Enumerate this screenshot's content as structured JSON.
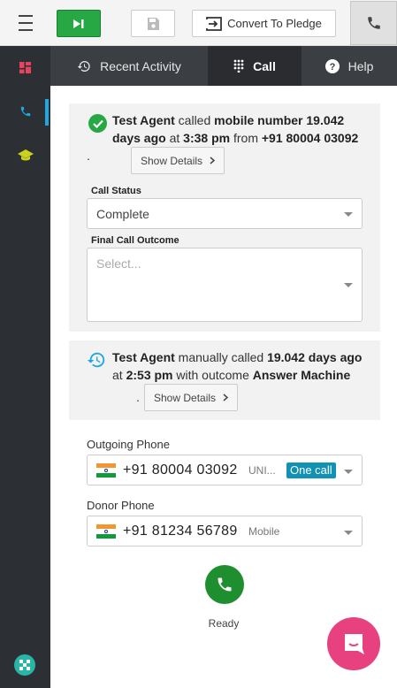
{
  "topbar": {
    "convert_label": "Convert To Pledge"
  },
  "tabs": [
    {
      "label": "Recent Activity"
    },
    {
      "label": "Call"
    },
    {
      "label": "Help"
    }
  ],
  "activity1": {
    "agent": "Test Agent",
    "verb": " called ",
    "target": "mobile number",
    "time_ago": "19.042 days ago",
    "at": " at ",
    "time": "3:38 pm",
    "from": " from ",
    "number": "+91 80004 03092",
    "period": ".",
    "show_details": "Show Details"
  },
  "call_status": {
    "label": "Call Status",
    "value": "Complete"
  },
  "final_outcome": {
    "label": "Final Call Outcome",
    "placeholder": "Select..."
  },
  "activity2": {
    "agent": "Test Agent",
    "verb": " manually called ",
    "time_ago": "19.042 days ago",
    "at": " at ",
    "time": "2:53 pm",
    "with": " with outcome ",
    "outcome": "Answer Machine",
    "period": ".",
    "show_details": "Show Details"
  },
  "outgoing_phone": {
    "label": "Outgoing Phone",
    "number": "+91 80004 03092",
    "type": "UNI...",
    "badge": "One call"
  },
  "donor_phone": {
    "label": "Donor Phone",
    "number": "+91 81234 56789",
    "type": "Mobile"
  },
  "call_state": "Ready",
  "colors": {
    "sidebar_bg": "#2c2f33",
    "tab_bg": "#3b3f44",
    "active_tab_bg": "#2a2c30",
    "success_green": "#28a745",
    "call_green": "#1e8e2e",
    "accent_blue": "#1ea7e1",
    "badge_blue": "#1192b5",
    "chat_pink": "#e8417f",
    "dashboard_red": "#e8435a",
    "education_yellow": "#c9d21c"
  },
  "icons": [
    "menu-icon",
    "skip-next-icon",
    "save-icon",
    "convert-icon",
    "phone-icon",
    "dashboard-icon",
    "phone-icon",
    "school-icon",
    "app-logo-icon",
    "history-icon",
    "dialpad-icon",
    "help-icon",
    "check-circle-icon",
    "chevron-right-icon",
    "chevron-down-icon",
    "india-flag-icon",
    "chat-icon"
  ]
}
